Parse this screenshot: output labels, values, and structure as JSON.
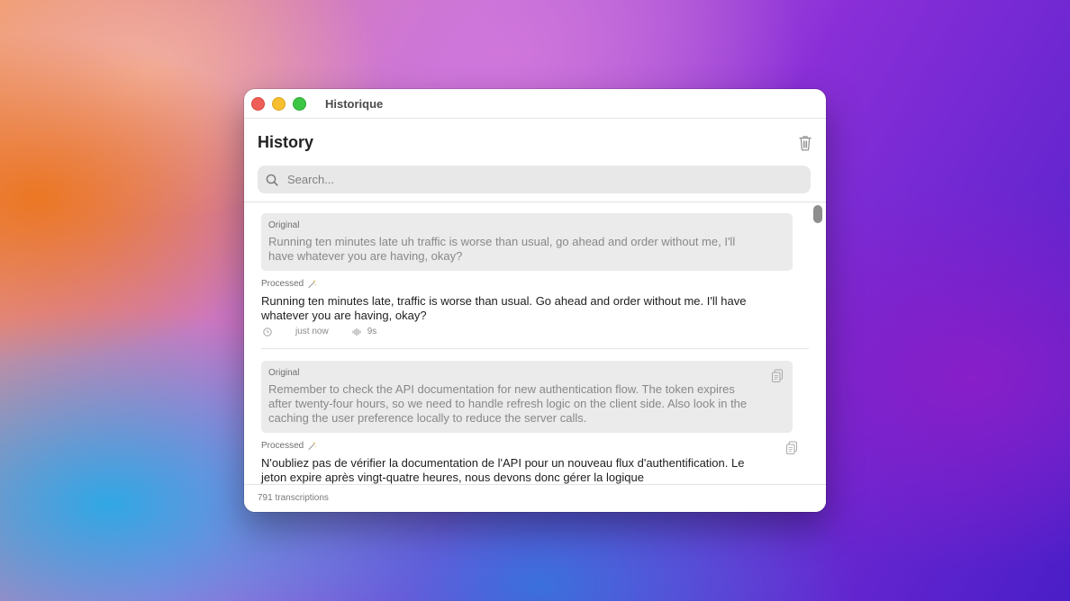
{
  "window": {
    "title": "Historique"
  },
  "header": {
    "title": "History"
  },
  "search": {
    "placeholder": "Search..."
  },
  "entries": [
    {
      "original_label": "Original",
      "original_text": "Running ten minutes late uh traffic is worse than usual, go ahead and order without me, I'll have whatever you are having, okay?",
      "processed_label": "Processed",
      "processed_text": "Running ten minutes late, traffic is worse than usual. Go ahead and order without me. I'll have whatever you are having, okay?",
      "time": "just now",
      "duration": "9s"
    },
    {
      "original_label": "Original",
      "original_text": "Remember to check the API documentation for new authentication flow. The token expires after twenty-four hours, so we need to handle refresh logic on the client side. Also look in the caching the user preference locally to reduce the server calls.",
      "processed_label": "Processed",
      "processed_text": "N'oubliez pas de vérifier la documentation de l'API pour un nouveau flux d'authentification. Le jeton expire après vingt-quatre heures, nous devons donc gérer la logique"
    }
  ],
  "footer": {
    "count": "791 transcriptions"
  },
  "colors": {
    "accent_red": "#ee5f58",
    "accent_yellow": "#f7bf2e",
    "accent_green": "#3dc645",
    "processed_icon": "#d4a017"
  },
  "icons": [
    "close-icon",
    "minimize-icon",
    "zoom-icon",
    "trash-icon",
    "search-icon",
    "sparkle-icon",
    "clock-icon",
    "waveform-icon",
    "copy-icon"
  ]
}
